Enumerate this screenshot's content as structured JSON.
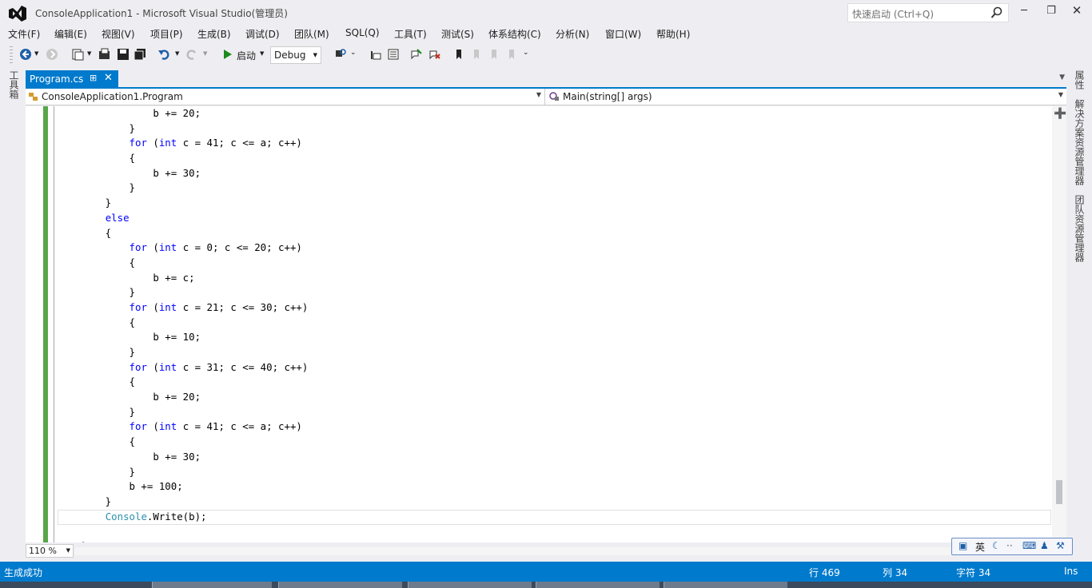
{
  "window": {
    "title": "ConsoleApplication1 - Microsoft Visual Studio(管理员)",
    "quick_launch_placeholder": "快速启动 (Ctrl+Q)"
  },
  "menu": [
    "文件(F)",
    "编辑(E)",
    "视图(V)",
    "项目(P)",
    "生成(B)",
    "调试(D)",
    "团队(M)",
    "SQL(Q)",
    "工具(T)",
    "测试(S)",
    "体系结构(C)",
    "分析(N)",
    "窗口(W)",
    "帮助(H)"
  ],
  "toolbar": {
    "start_label": "启动",
    "config_value": "Debug"
  },
  "left_panel": {
    "toolbox_label": "工具箱"
  },
  "right_panel": {
    "properties_label": "属性",
    "solution_explorer_label": "解决方案资源管理器",
    "team_explorer_label": "团队资源管理器"
  },
  "tab": {
    "name": "Program.cs"
  },
  "navbar": {
    "type_selector": "ConsoleApplication1.Program",
    "member_selector": "Main(string[] args)"
  },
  "code_lines": [
    "                b += 20;",
    "            }",
    "            for (int c = 41; c <= a; c++)",
    "            {",
    "                b += 30;",
    "            }",
    "        }",
    "        else",
    "        {",
    "            for (int c = 0; c <= 20; c++)",
    "            {",
    "                b += c;",
    "            }",
    "            for (int c = 21; c <= 30; c++)",
    "            {",
    "                b += 10;",
    "            }",
    "            for (int c = 31; c <= 40; c++)",
    "            {",
    "                b += 20;",
    "            }",
    "            for (int c = 41; c <= a; c++)",
    "            {",
    "                b += 30;",
    "            }",
    "            b += 100;",
    "        }",
    "        Console.Write(b);",
    "",
    "    }"
  ],
  "zoom": "110 %",
  "ime": {
    "lang": "英"
  },
  "status": {
    "message": "生成成功",
    "line": "行 469",
    "col": "列 34",
    "char": "字符 34",
    "mode": "Ins"
  },
  "colors": {
    "accent": "#007acc",
    "keyword": "#0000ff",
    "type": "#2b91af",
    "change_margin": "#57a64a"
  }
}
